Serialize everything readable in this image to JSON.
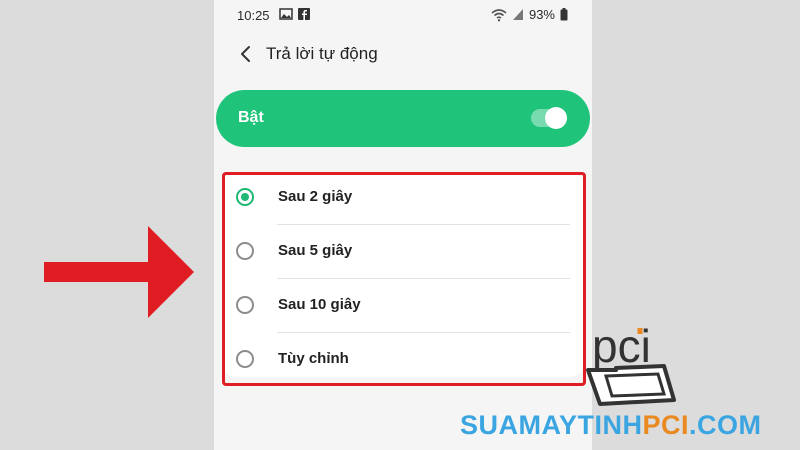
{
  "status_bar": {
    "time": "10:25",
    "battery": "93%"
  },
  "header": {
    "title": "Trả lời tự động"
  },
  "toggle": {
    "label": "Bật",
    "on": true
  },
  "options": [
    {
      "label": "Sau 2 giây",
      "selected": true
    },
    {
      "label": "Sau 5 giây",
      "selected": false
    },
    {
      "label": "Sau 10 giây",
      "selected": false
    },
    {
      "label": "Tùy chỉnh",
      "selected": false
    }
  ],
  "watermark": {
    "brand_main": "SUAMAYTINH",
    "brand_accent": "PCI",
    "brand_suffix": ".COM",
    "logo_text": "pci"
  },
  "colors": {
    "accent_green": "#1fc47a",
    "highlight_red": "#e01c24",
    "brand_blue": "#3ba5e2",
    "brand_orange": "#e9891f"
  },
  "icons": {
    "back": "chevron-left-icon",
    "wifi": "wifi-icon",
    "signal": "signal-icon",
    "battery": "battery-icon",
    "gallery": "image-icon",
    "facebook": "facebook-icon"
  }
}
